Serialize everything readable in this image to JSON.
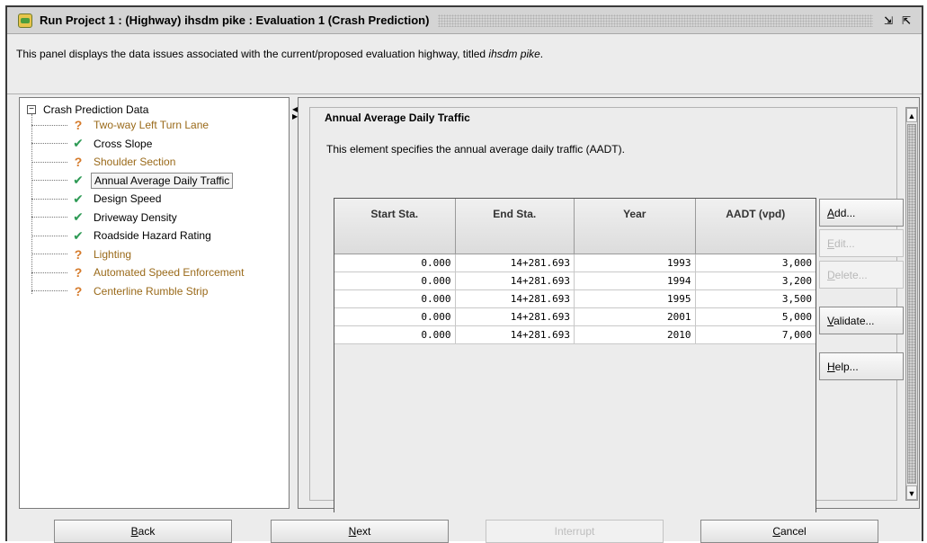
{
  "window": {
    "title": "Run Project 1 : (Highway) ihsdm pike : Evaluation 1 (Crash Prediction)"
  },
  "description": {
    "prefix": "This panel displays the data issues associated with the current/proposed evaluation highway, titled ",
    "highway_name": "ihsdm pike",
    "suffix": "."
  },
  "tree": {
    "root_label": "Crash Prediction Data",
    "root_expander": "−",
    "items": [
      {
        "label": "Two-way Left Turn Lane",
        "status": "issue",
        "icon": "question-icon"
      },
      {
        "label": "Cross Slope",
        "status": "ok",
        "icon": "check-icon"
      },
      {
        "label": "Shoulder Section",
        "status": "issue",
        "icon": "question-icon"
      },
      {
        "label": "Annual Average Daily Traffic",
        "status": "ok",
        "icon": "check-icon",
        "selected": true
      },
      {
        "label": "Design Speed",
        "status": "ok",
        "icon": "check-icon"
      },
      {
        "label": "Driveway Density",
        "status": "ok",
        "icon": "check-icon"
      },
      {
        "label": "Roadside Hazard Rating",
        "status": "ok",
        "icon": "check-icon"
      },
      {
        "label": "Lighting",
        "status": "issue",
        "icon": "question-icon"
      },
      {
        "label": "Automated Speed Enforcement",
        "status": "issue",
        "icon": "question-icon"
      },
      {
        "label": "Centerline Rumble Strip",
        "status": "issue",
        "icon": "question-icon"
      }
    ]
  },
  "element": {
    "title": "Annual Average Daily Traffic",
    "description": "This element specifies the annual average daily traffic (AADT).",
    "columns": [
      "Start Sta.",
      "End Sta.",
      "Year",
      "AADT (vpd)"
    ],
    "rows": [
      [
        "0.000",
        "14+281.693",
        "1993",
        "3,000"
      ],
      [
        "0.000",
        "14+281.693",
        "1994",
        "3,200"
      ],
      [
        "0.000",
        "14+281.693",
        "1995",
        "3,500"
      ],
      [
        "0.000",
        "14+281.693",
        "2001",
        "5,000"
      ],
      [
        "0.000",
        "14+281.693",
        "2010",
        "7,000"
      ]
    ],
    "buttons": {
      "add": {
        "mnemonic": "A",
        "rest": "dd..."
      },
      "edit": {
        "mnemonic": "E",
        "rest": "dit..."
      },
      "delete": {
        "mnemonic": "D",
        "rest": "elete..."
      },
      "validate": {
        "mnemonic": "V",
        "rest": "alidate..."
      },
      "help": {
        "mnemonic": "H",
        "rest": "elp..."
      }
    }
  },
  "footer": {
    "back": {
      "mnemonic": "B",
      "rest": "ack"
    },
    "next": {
      "mnemonic": "N",
      "rest": "ext"
    },
    "interrupt": "Interrupt",
    "cancel": {
      "mnemonic": "C",
      "rest": "ancel"
    }
  },
  "colors": {
    "issue_text": "#9a6a1a",
    "check_icon": "#2e9a55",
    "question_icon": "#d57a2a"
  }
}
